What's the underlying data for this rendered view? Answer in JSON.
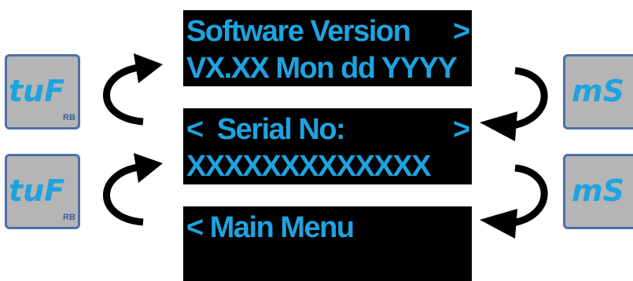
{
  "screens": [
    {
      "line1": "Software Version",
      "line1_right": ">",
      "line2": "VX.XX Mon dd YYYY"
    },
    {
      "line1": "<  Serial No:",
      "line1_right": ">",
      "line2": "XXXXXXXXXXXXX"
    },
    {
      "line1": "< Main Menu",
      "line1_right": "",
      "line2": ""
    }
  ],
  "keys": {
    "left": [
      {
        "label": "tuF",
        "sub": "RB"
      },
      {
        "label": "tuF",
        "sub": "RB"
      }
    ],
    "right": [
      {
        "label": "mS"
      },
      {
        "label": "mS"
      }
    ]
  },
  "colors": {
    "lcd_background": "#000000",
    "lcd_text": "#1ea3e0",
    "key_face": "#b5b5b5",
    "key_border": "#4f6fa8",
    "arrow": "#000000"
  }
}
